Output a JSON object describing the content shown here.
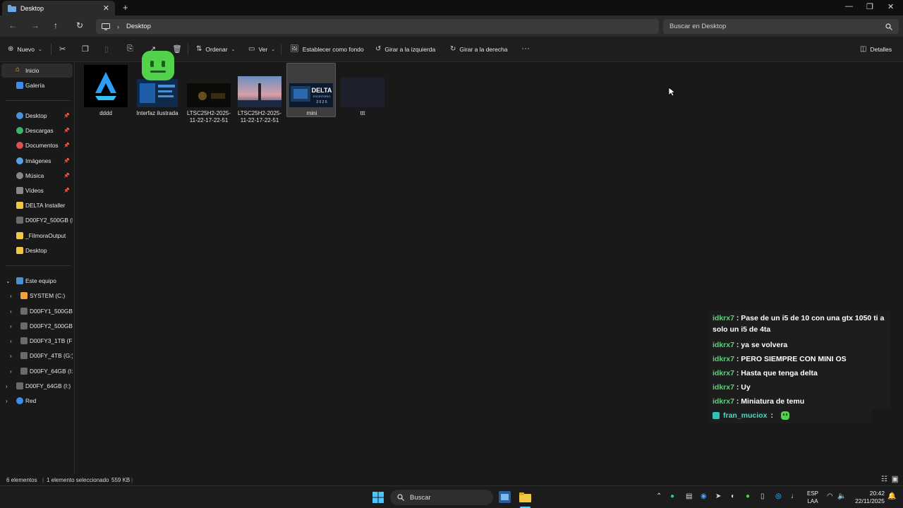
{
  "window": {
    "tab_title": "Desktop"
  },
  "address": {
    "path": "Desktop",
    "search_placeholder": "Buscar en Desktop"
  },
  "toolbar": {
    "new_label": "Nuevo",
    "sort_label": "Ordenar",
    "view_label": "Ver",
    "set_bg_label": "Establecer como fondo",
    "rotate_left_label": "Girar a la izquierda",
    "rotate_right_label": "Girar a la derecha",
    "details_label": "Detalles"
  },
  "sidebar": {
    "items": [
      {
        "label": "Inicio"
      },
      {
        "label": "Galería"
      },
      {
        "label": "Desktop"
      },
      {
        "label": "Descargas"
      },
      {
        "label": "Documentos"
      },
      {
        "label": "Imágenes"
      },
      {
        "label": "Música"
      },
      {
        "label": "Vídeos"
      },
      {
        "label": "DELTA Installer"
      },
      {
        "label": "D00FY2_500GB (E:)"
      },
      {
        "label": "_FilmoraOutput"
      },
      {
        "label": "Desktop"
      },
      {
        "label": "Este equipo"
      },
      {
        "label": "SYSTEM (C:)"
      },
      {
        "label": "D00FY1_500GB (D:"
      },
      {
        "label": "D00FY2_500GB (E:"
      },
      {
        "label": "D00FY3_1TB (F:)"
      },
      {
        "label": "D00FY_4TB (G:)"
      },
      {
        "label": "D00FY_64GB (I:)"
      },
      {
        "label": "D00FY_64GB (I:)"
      },
      {
        "label": "Red"
      }
    ]
  },
  "files": [
    {
      "name": "dddd"
    },
    {
      "name": "Interfaz ilustrada"
    },
    {
      "name": "LTSC25H2-2025-11-22-17-22-51"
    },
    {
      "name": "LTSC25H2-2025-11-22-17-22-51"
    },
    {
      "name": "mini"
    },
    {
      "name": "ttt"
    }
  ],
  "thumb_text": {
    "delta": "DELTA",
    "delta_sub": "ESCRITORIO",
    "delta_year": "2 0 2 6"
  },
  "status": {
    "count": "6 elementos",
    "selection": "1 elemento seleccionado",
    "size": "559 KB"
  },
  "chat": {
    "messages": [
      {
        "user": "idkrx7",
        "text": "Pase de un i5 de 10 con una gtx 1050 ti a solo un i5 de 4ta"
      },
      {
        "user": "idkrx7",
        "text": "ya se volvera"
      },
      {
        "user": "idkrx7",
        "text": "PERO SIEMPRE CON MINI OS"
      },
      {
        "user": "idkrx7",
        "text": "Hasta que tenga delta"
      },
      {
        "user": "idkrx7",
        "text": "Uy"
      },
      {
        "user": "idkrx7",
        "text": "Miniatura de temu"
      },
      {
        "user": "fran_muciox",
        "text": ""
      }
    ],
    "separator": ":"
  },
  "taskbar": {
    "search_label": "Buscar",
    "lang_top": "ESP",
    "lang_bottom": "LAA",
    "time": "20:42",
    "date": "22/11/2025"
  },
  "colors": {
    "accent_blue": "#3b8eea",
    "chat_user_green": "#56d67a",
    "folder_yellow": "#f2c744"
  }
}
